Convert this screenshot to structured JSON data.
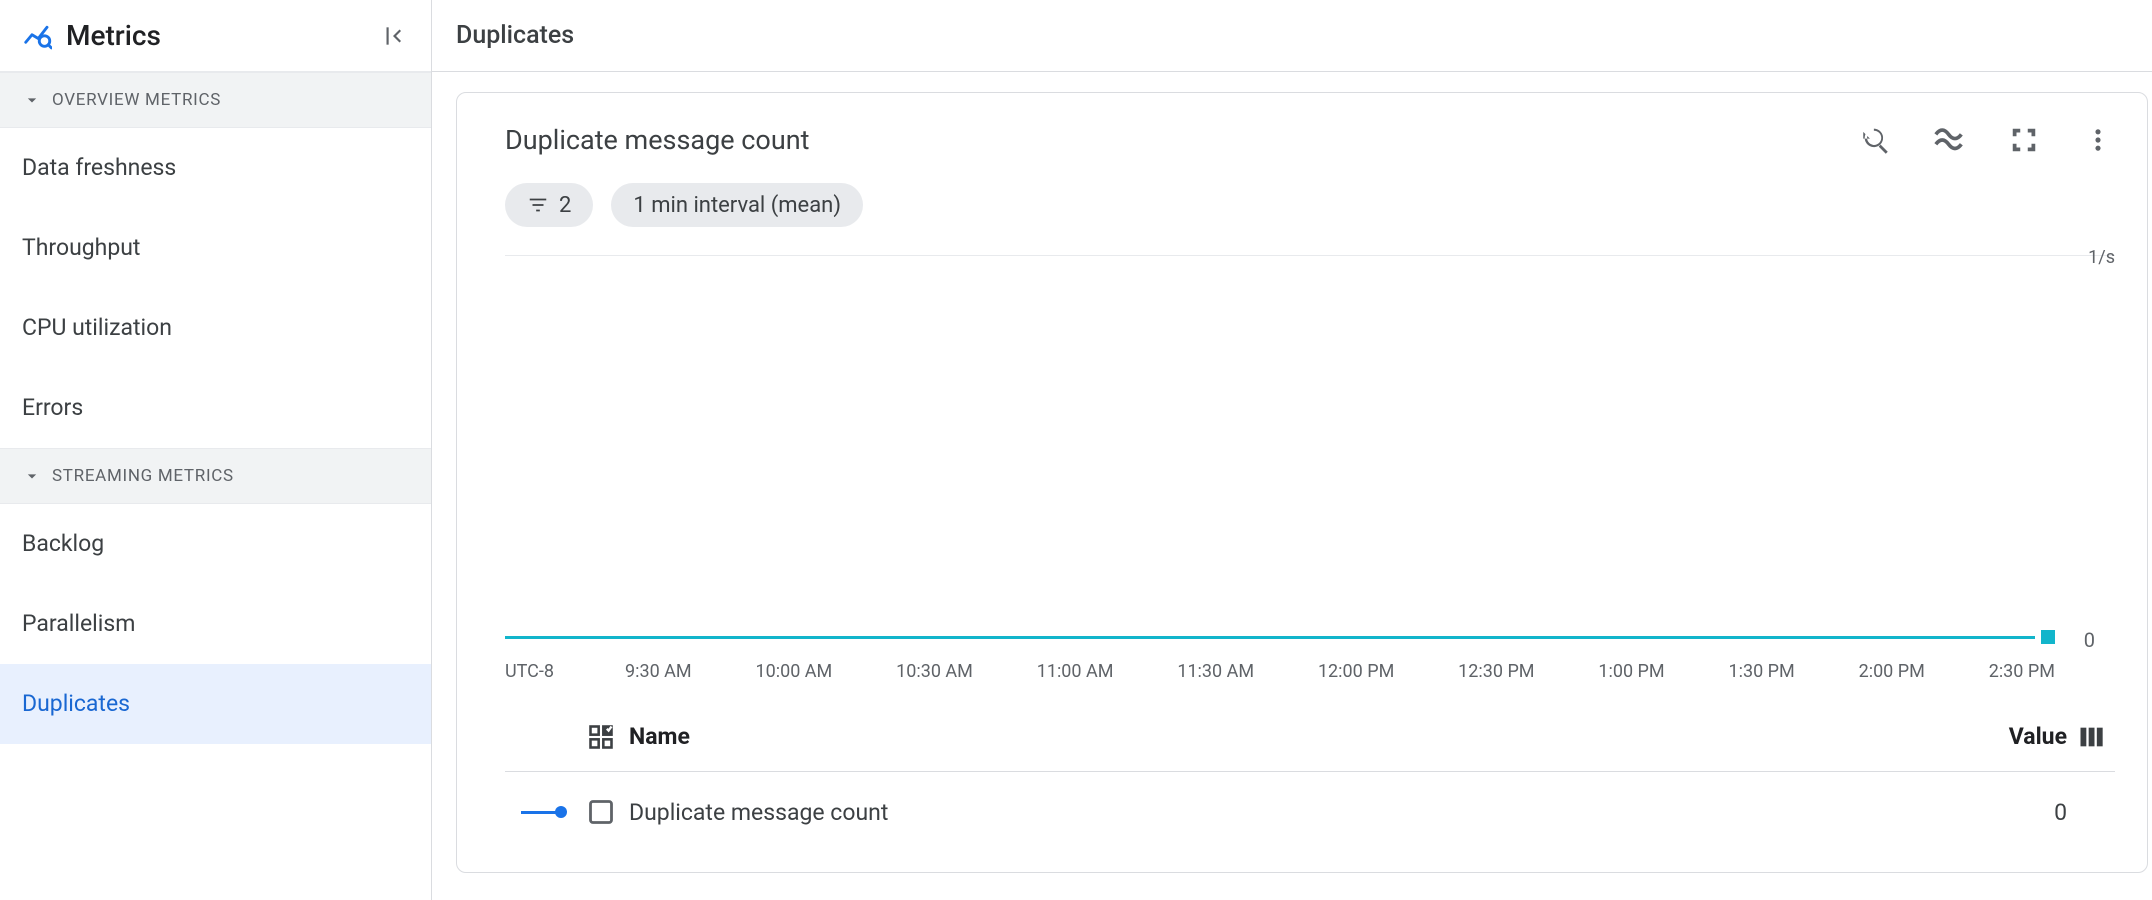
{
  "sidebar": {
    "title": "Metrics",
    "sections": [
      {
        "label": "OVERVIEW METRICS",
        "items": [
          {
            "label": "Data freshness",
            "selected": false
          },
          {
            "label": "Throughput",
            "selected": false
          },
          {
            "label": "CPU utilization",
            "selected": false
          },
          {
            "label": "Errors",
            "selected": false
          }
        ]
      },
      {
        "label": "STREAMING METRICS",
        "items": [
          {
            "label": "Backlog",
            "selected": false
          },
          {
            "label": "Parallelism",
            "selected": false
          },
          {
            "label": "Duplicates",
            "selected": true
          }
        ]
      }
    ]
  },
  "main": {
    "header_title": "Duplicates"
  },
  "card": {
    "title": "Duplicate message count",
    "filter_chip": "2",
    "interval_chip": "1 min interval (mean)"
  },
  "chart_data": {
    "type": "line",
    "title": "Duplicate message count",
    "yunit": "1/s",
    "y0_label": "0",
    "timezone": "UTC-8",
    "xticks": [
      "9:30 AM",
      "10:00 AM",
      "10:30 AM",
      "11:00 AM",
      "11:30 AM",
      "12:00 PM",
      "12:30 PM",
      "1:00 PM",
      "1:30 PM",
      "2:00 PM",
      "2:30 PM"
    ],
    "series": [
      {
        "name": "Duplicate message count",
        "color": "#12b5cb",
        "value": 0
      }
    ],
    "ylim": [
      0,
      1
    ]
  },
  "legend": {
    "name_header": "Name",
    "value_header": "Value",
    "rows": [
      {
        "name": "Duplicate message count",
        "value": "0",
        "color": "#1a73e8"
      }
    ]
  }
}
